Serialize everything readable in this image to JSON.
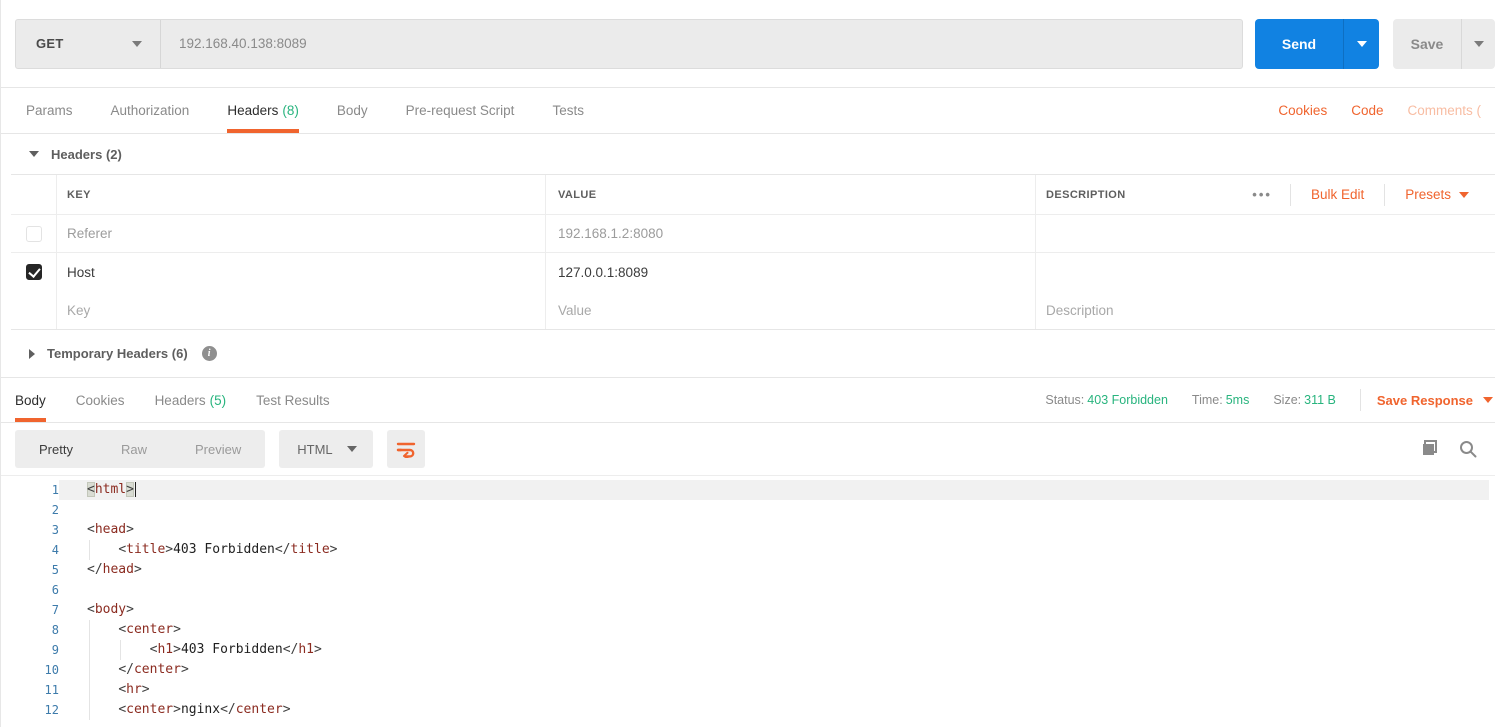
{
  "colors": {
    "accent_orange": "#f0642e",
    "faded_orange": "#f8bda3",
    "success_green": "#28b47e",
    "send_blue": "#1182e2",
    "code_tag_red": "#8b2b20",
    "gutter_blue": "#3d7bab"
  },
  "request": {
    "method": "GET",
    "url": "192.168.40.138:8089",
    "send_label": "Send",
    "save_label": "Save",
    "tabs": [
      {
        "label": "Params",
        "count": "",
        "active": false
      },
      {
        "label": "Authorization",
        "count": "",
        "active": false
      },
      {
        "label": "Headers",
        "count": "(8)",
        "active": true
      },
      {
        "label": "Body",
        "count": "",
        "active": false
      },
      {
        "label": "Pre-request Script",
        "count": "",
        "active": false
      },
      {
        "label": "Tests",
        "count": "",
        "active": false
      }
    ],
    "links": [
      {
        "label": "Cookies",
        "faded": false
      },
      {
        "label": "Code",
        "faded": false
      },
      {
        "label": "Comments (",
        "faded": true
      }
    ]
  },
  "headers_section": {
    "title": "Headers",
    "count": "(2)",
    "table": {
      "columns": {
        "key": "KEY",
        "value": "VALUE",
        "description": "DESCRIPTION"
      },
      "menu_dots": "•••",
      "bulk_edit_label": "Bulk Edit",
      "presets_label": "Presets",
      "rows": [
        {
          "key": "Referer",
          "value": "192.168.1.2:8080",
          "description": "",
          "checked": false,
          "muted": true
        },
        {
          "key": "Host",
          "value": "127.0.0.1:8089",
          "description": "",
          "checked": true,
          "muted": false
        }
      ],
      "placeholder_row": {
        "key": "Key",
        "value": "Value",
        "description": "Description"
      }
    },
    "temporary_title": "Temporary Headers",
    "temporary_count": "(6)"
  },
  "response": {
    "tabs": [
      {
        "label": "Body",
        "count": "",
        "active": true
      },
      {
        "label": "Cookies",
        "count": "",
        "active": false
      },
      {
        "label": "Headers",
        "count": "(5)",
        "active": false
      },
      {
        "label": "Test Results",
        "count": "",
        "active": false
      }
    ],
    "status_label": "Status:",
    "status_value": "403 Forbidden",
    "time_label": "Time:",
    "time_value": "5ms",
    "size_label": "Size:",
    "size_value": "311 B",
    "save_response_label": "Save Response",
    "view_modes": [
      {
        "label": "Pretty",
        "active": true
      },
      {
        "label": "Raw",
        "active": false
      },
      {
        "label": "Preview",
        "active": false
      }
    ],
    "language": "HTML"
  },
  "code": {
    "lines": [
      {
        "n": "1",
        "guides": 0,
        "active": true,
        "tokens": [
          {
            "c": "mb",
            "v": "<"
          },
          {
            "c": "tag",
            "v": "html"
          },
          {
            "c": "mb",
            "v": ">"
          },
          {
            "c": "cursor",
            "v": ""
          }
        ]
      },
      {
        "n": "2",
        "guides": 0,
        "active": false,
        "tokens": []
      },
      {
        "n": "3",
        "guides": 0,
        "active": false,
        "tokens": [
          {
            "c": "punct",
            "v": "<"
          },
          {
            "c": "tag",
            "v": "head"
          },
          {
            "c": "punct",
            "v": ">"
          }
        ]
      },
      {
        "n": "4",
        "guides": 1,
        "active": false,
        "tokens": [
          {
            "c": "text",
            "v": "    "
          },
          {
            "c": "punct",
            "v": "<"
          },
          {
            "c": "tag",
            "v": "title"
          },
          {
            "c": "punct",
            "v": ">"
          },
          {
            "c": "text",
            "v": "403 Forbidden"
          },
          {
            "c": "punct",
            "v": "</"
          },
          {
            "c": "tag",
            "v": "title"
          },
          {
            "c": "punct",
            "v": ">"
          }
        ]
      },
      {
        "n": "5",
        "guides": 0,
        "active": false,
        "tokens": [
          {
            "c": "punct",
            "v": "</"
          },
          {
            "c": "tag",
            "v": "head"
          },
          {
            "c": "punct",
            "v": ">"
          }
        ]
      },
      {
        "n": "6",
        "guides": 0,
        "active": false,
        "tokens": []
      },
      {
        "n": "7",
        "guides": 0,
        "active": false,
        "tokens": [
          {
            "c": "punct",
            "v": "<"
          },
          {
            "c": "tag",
            "v": "body"
          },
          {
            "c": "punct",
            "v": ">"
          }
        ]
      },
      {
        "n": "8",
        "guides": 1,
        "active": false,
        "tokens": [
          {
            "c": "text",
            "v": "    "
          },
          {
            "c": "punct",
            "v": "<"
          },
          {
            "c": "tag",
            "v": "center"
          },
          {
            "c": "punct",
            "v": ">"
          }
        ]
      },
      {
        "n": "9",
        "guides": 2,
        "active": false,
        "tokens": [
          {
            "c": "text",
            "v": "        "
          },
          {
            "c": "punct",
            "v": "<"
          },
          {
            "c": "tag",
            "v": "h1"
          },
          {
            "c": "punct",
            "v": ">"
          },
          {
            "c": "text",
            "v": "403 Forbidden"
          },
          {
            "c": "punct",
            "v": "</"
          },
          {
            "c": "tag",
            "v": "h1"
          },
          {
            "c": "punct",
            "v": ">"
          }
        ]
      },
      {
        "n": "10",
        "guides": 1,
        "active": false,
        "tokens": [
          {
            "c": "text",
            "v": "    "
          },
          {
            "c": "punct",
            "v": "</"
          },
          {
            "c": "tag",
            "v": "center"
          },
          {
            "c": "punct",
            "v": ">"
          }
        ]
      },
      {
        "n": "11",
        "guides": 1,
        "active": false,
        "tokens": [
          {
            "c": "text",
            "v": "    "
          },
          {
            "c": "punct",
            "v": "<"
          },
          {
            "c": "tag",
            "v": "hr"
          },
          {
            "c": "punct",
            "v": ">"
          }
        ]
      },
      {
        "n": "12",
        "guides": 1,
        "active": false,
        "tokens": [
          {
            "c": "text",
            "v": "    "
          },
          {
            "c": "punct",
            "v": "<"
          },
          {
            "c": "tag",
            "v": "center"
          },
          {
            "c": "punct",
            "v": ">"
          },
          {
            "c": "text",
            "v": "nginx"
          },
          {
            "c": "punct",
            "v": "</"
          },
          {
            "c": "tag",
            "v": "center"
          },
          {
            "c": "punct",
            "v": ">"
          }
        ]
      }
    ]
  }
}
